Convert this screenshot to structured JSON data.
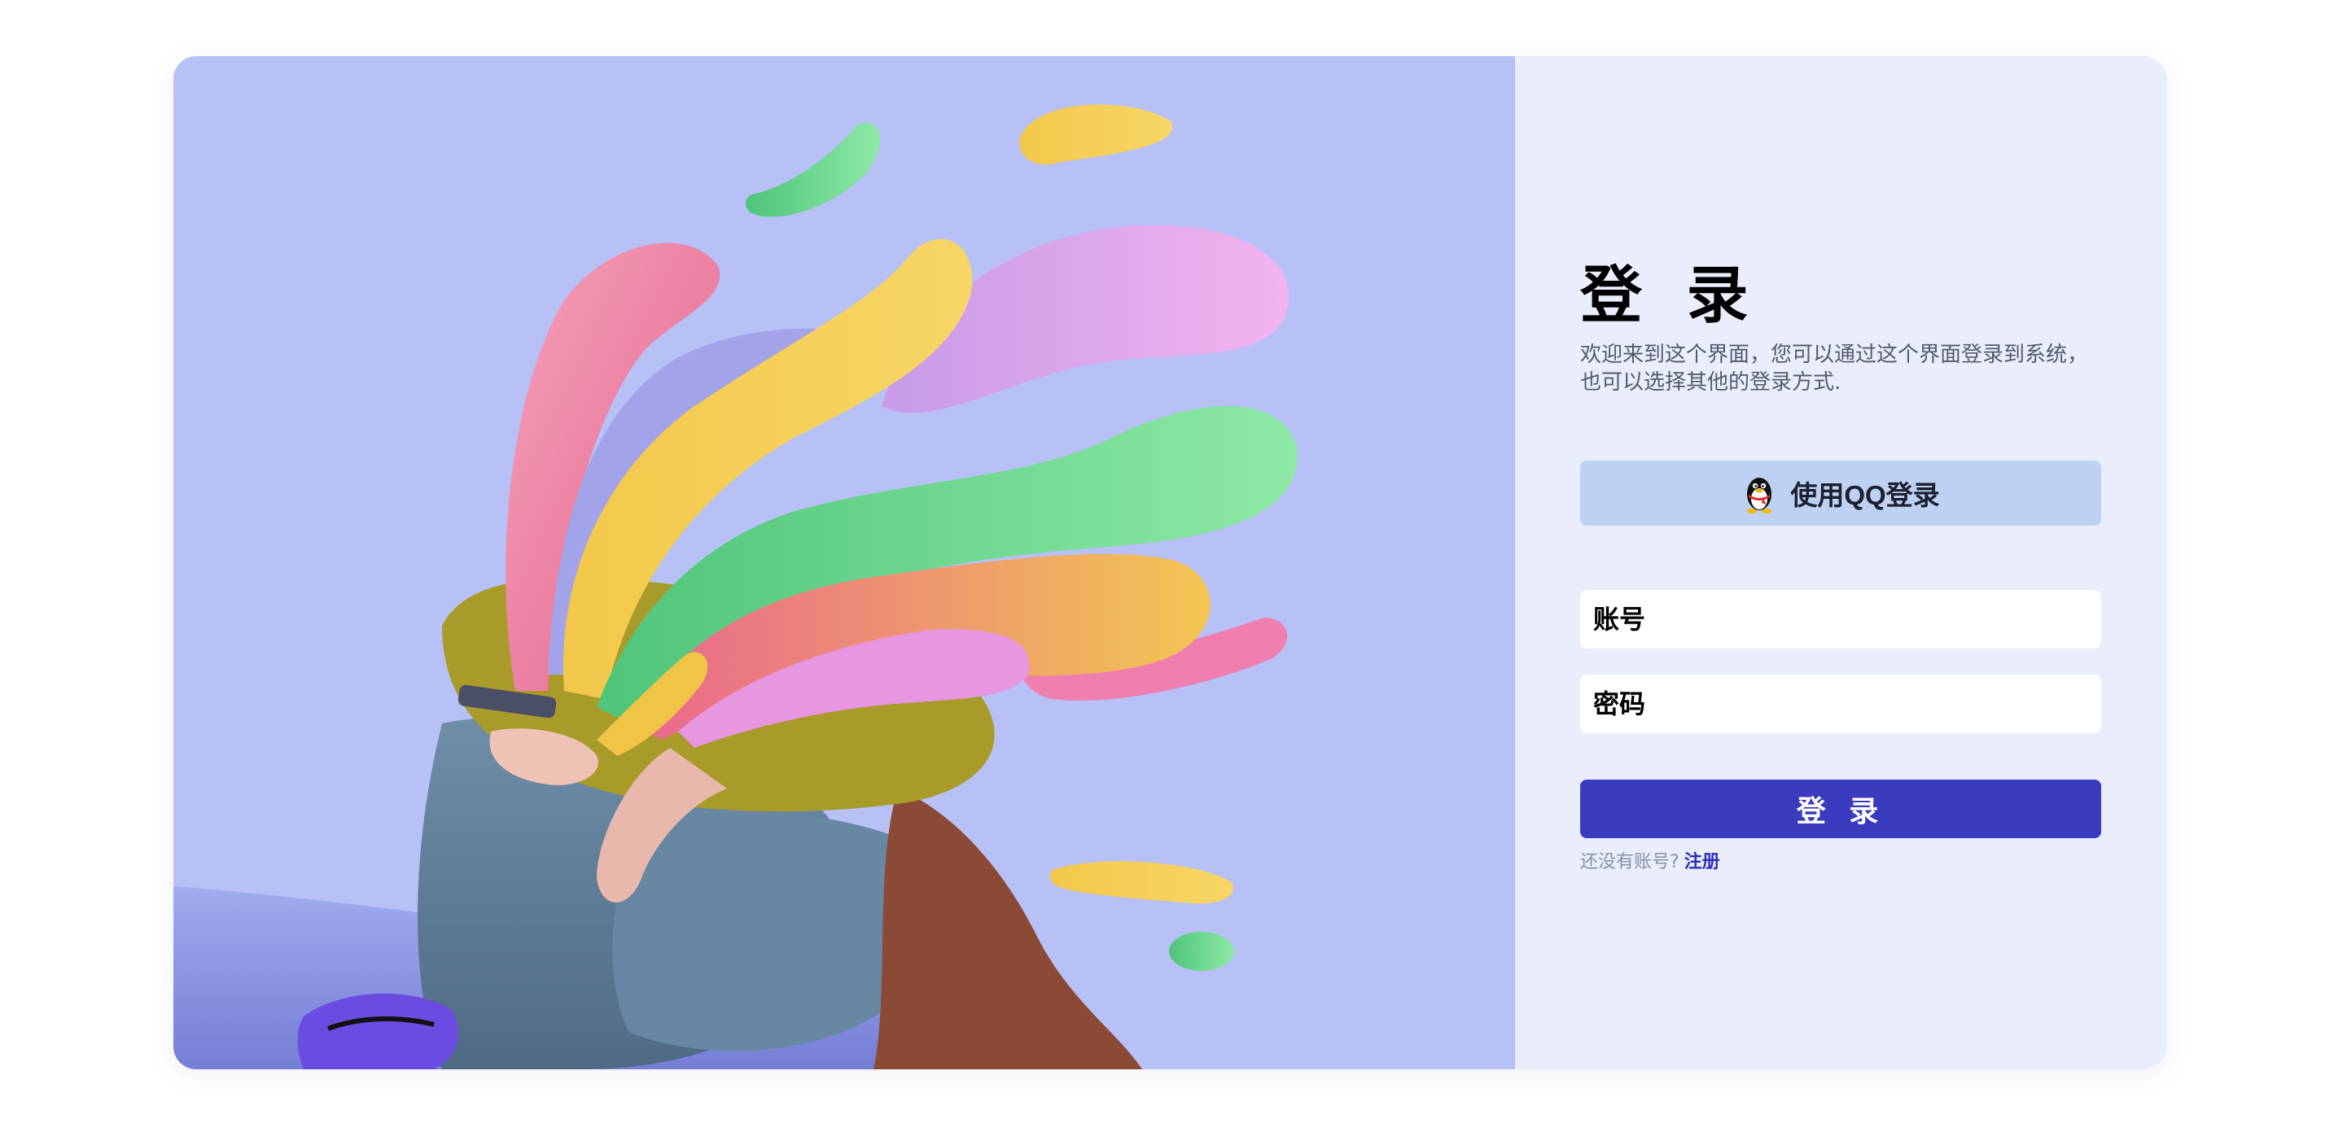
{
  "login": {
    "title": "登 录",
    "subtitle": "欢迎来到这个界面，您可以通过这个界面登录到系统，也可以选择其他的登录方式.",
    "qq_button_label": "使用QQ登录",
    "account_placeholder": "账号",
    "password_placeholder": "密码",
    "submit_label": "登 录",
    "register_prompt": "还没有账号?",
    "register_link": "注册"
  },
  "icons": {
    "qq": "qq-penguin-icon"
  },
  "colors": {
    "hero_background": "#b7c1f6",
    "panel_background": "#eaedfc",
    "qq_button": "#bdd1f3",
    "submit_button": "#3a3bbf",
    "register_link": "#2a2fb8"
  }
}
